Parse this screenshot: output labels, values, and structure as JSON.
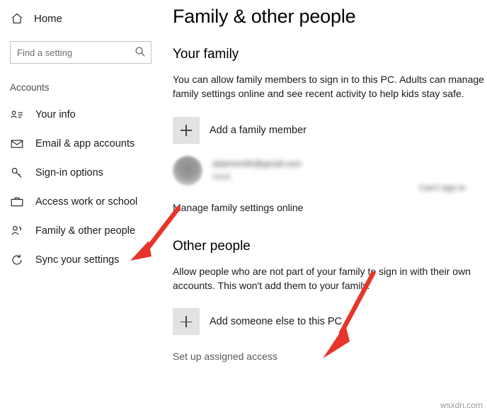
{
  "sidebar": {
    "home": {
      "label": "Home",
      "icon": "home-icon"
    },
    "search": {
      "placeholder": "Find a setting",
      "value": "",
      "icon": "search-icon"
    },
    "section_label": "Accounts",
    "items": [
      {
        "label": "Your info",
        "icon": "person-card-icon"
      },
      {
        "label": "Email & app accounts",
        "icon": "envelope-icon"
      },
      {
        "label": "Sign-in options",
        "icon": "key-icon"
      },
      {
        "label": "Access work or school",
        "icon": "briefcase-icon"
      },
      {
        "label": "Family & other people",
        "icon": "people-icon"
      },
      {
        "label": "Sync your settings",
        "icon": "sync-icon"
      }
    ]
  },
  "main": {
    "title": "Family & other people",
    "family": {
      "heading": "Your family",
      "description": "You can allow family members to sign in to this PC. Adults can manage family settings online and see recent activity to help kids stay safe.",
      "add_label": "Add a family member",
      "account_name": "adamsmith@gmail.com",
      "account_status": "Adult",
      "account_right": "Can't sign in",
      "manage_link": "Manage family settings online"
    },
    "other": {
      "heading": "Other people",
      "description": "Allow people who are not part of your family to sign in with their own accounts. This won't add them to your family.",
      "add_label": "Add someone else to this PC",
      "assigned_access_link": "Set up assigned access"
    }
  },
  "annotations": {
    "arrow_color": "#e8342a",
    "arrow_top_target": "Family & other people",
    "arrow_bottom_target": "Add someone else to this PC"
  },
  "watermark": {
    "text": "wsxdn.com"
  }
}
